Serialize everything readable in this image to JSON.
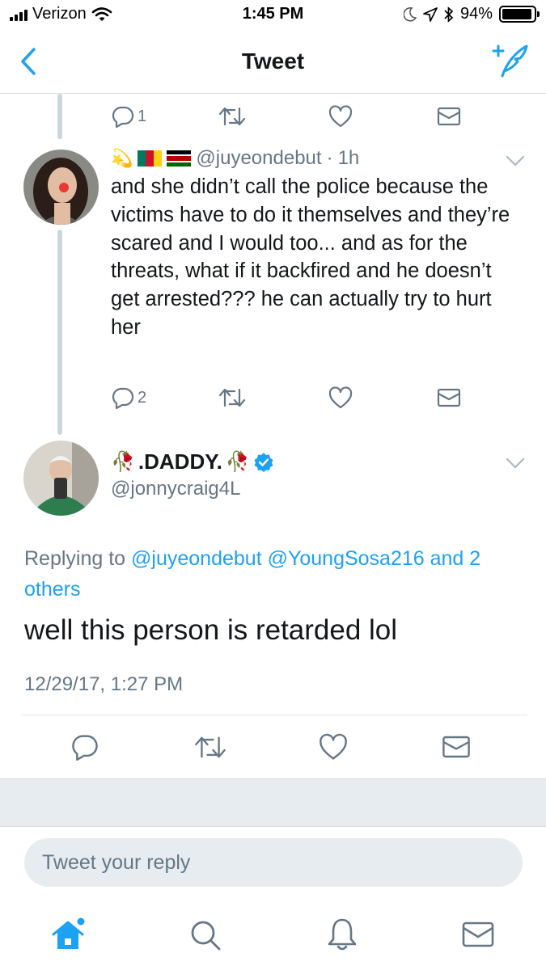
{
  "status_bar": {
    "carrier": "Verizon",
    "time": "1:45 PM",
    "battery_percent": "94%",
    "battery_level": 0.94
  },
  "nav": {
    "title": "Tweet",
    "back_icon": "chevron-left-icon",
    "compose_icon": "compose-tweet-icon"
  },
  "parent_tweet_actions": {
    "reply_count": "1"
  },
  "reply_tweet": {
    "name_emoji": [
      "💫",
      "🇨🇲",
      "🇰🇪"
    ],
    "handle": "@juyeondebut",
    "separator": "·",
    "age": "1h",
    "text": "and she didn’t call the police because the victims have to do it themselves and they’re scared and I would too... and as for the threats, what if it backfired and he doesn’t get arrested??? he can actually try to hurt her",
    "reply_count": "2"
  },
  "main_tweet": {
    "name": ".DADDY.",
    "name_prefix_emoji": "🥀",
    "name_suffix_emoji": "🥀",
    "verified": true,
    "handle": "@jonnycraig4L",
    "replying_prefix": "Replying to",
    "replying_to_1": "@juyeondebut",
    "replying_to_2": "@YoungSosa216",
    "replying_and": "and",
    "replying_others": "2 others",
    "text": "well this person is retarded lol",
    "timestamp": "12/29/17, 1:27 PM"
  },
  "composer": {
    "placeholder": "Tweet your reply"
  },
  "tab_bar": {
    "items": [
      "home-icon",
      "search-icon",
      "notifications-icon",
      "messages-icon"
    ]
  },
  "colors": {
    "accent": "#1da1f2",
    "secondary_text": "#657786",
    "thread_line": "#ccd6dd",
    "band": "#e6ecf0"
  }
}
